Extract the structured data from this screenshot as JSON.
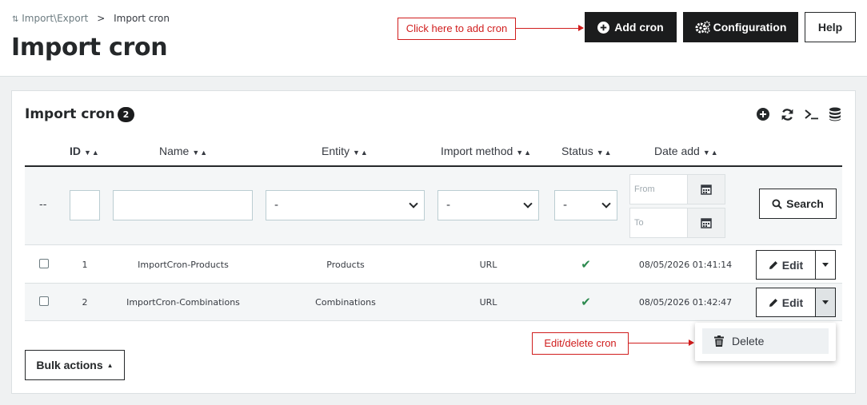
{
  "breadcrumb": {
    "parent": "Import\\Export",
    "separator": ">",
    "current": "Import cron"
  },
  "page_title": "Import cron",
  "annotations": {
    "add_cron_hint": "Click here to add cron",
    "edit_delete_hint": "Edit/delete cron"
  },
  "toolbar": {
    "add_label": "Add cron",
    "config_label": "Configuration",
    "help_label": "Help"
  },
  "panel": {
    "title": "Import cron",
    "count": "2"
  },
  "table": {
    "headers": {
      "id": "ID",
      "name": "Name",
      "entity": "Entity",
      "import_method": "Import method",
      "status": "Status",
      "date_add": "Date add"
    },
    "filters": {
      "bulk_placeholder": "--",
      "entity_value": "-",
      "method_value": "-",
      "status_value": "-",
      "date_from_placeholder": "From",
      "date_to_placeholder": "To",
      "search_label": "Search"
    },
    "rows": [
      {
        "id": "1",
        "name": "ImportCron-Products",
        "entity": "Products",
        "method": "URL",
        "status": "enabled",
        "date": "08/05/2026 01:41:14",
        "edit_label": "Edit"
      },
      {
        "id": "2",
        "name": "ImportCron-Combinations",
        "entity": "Combinations",
        "method": "URL",
        "status": "enabled",
        "date": "08/05/2026 01:42:47",
        "edit_label": "Edit"
      }
    ]
  },
  "bulk_actions_label": "Bulk actions",
  "dropdown": {
    "delete_label": "Delete"
  },
  "colors": {
    "dark_button": "#1b1c1d",
    "annotation_red": "#d01d1d",
    "status_green": "#2d8a4f"
  }
}
